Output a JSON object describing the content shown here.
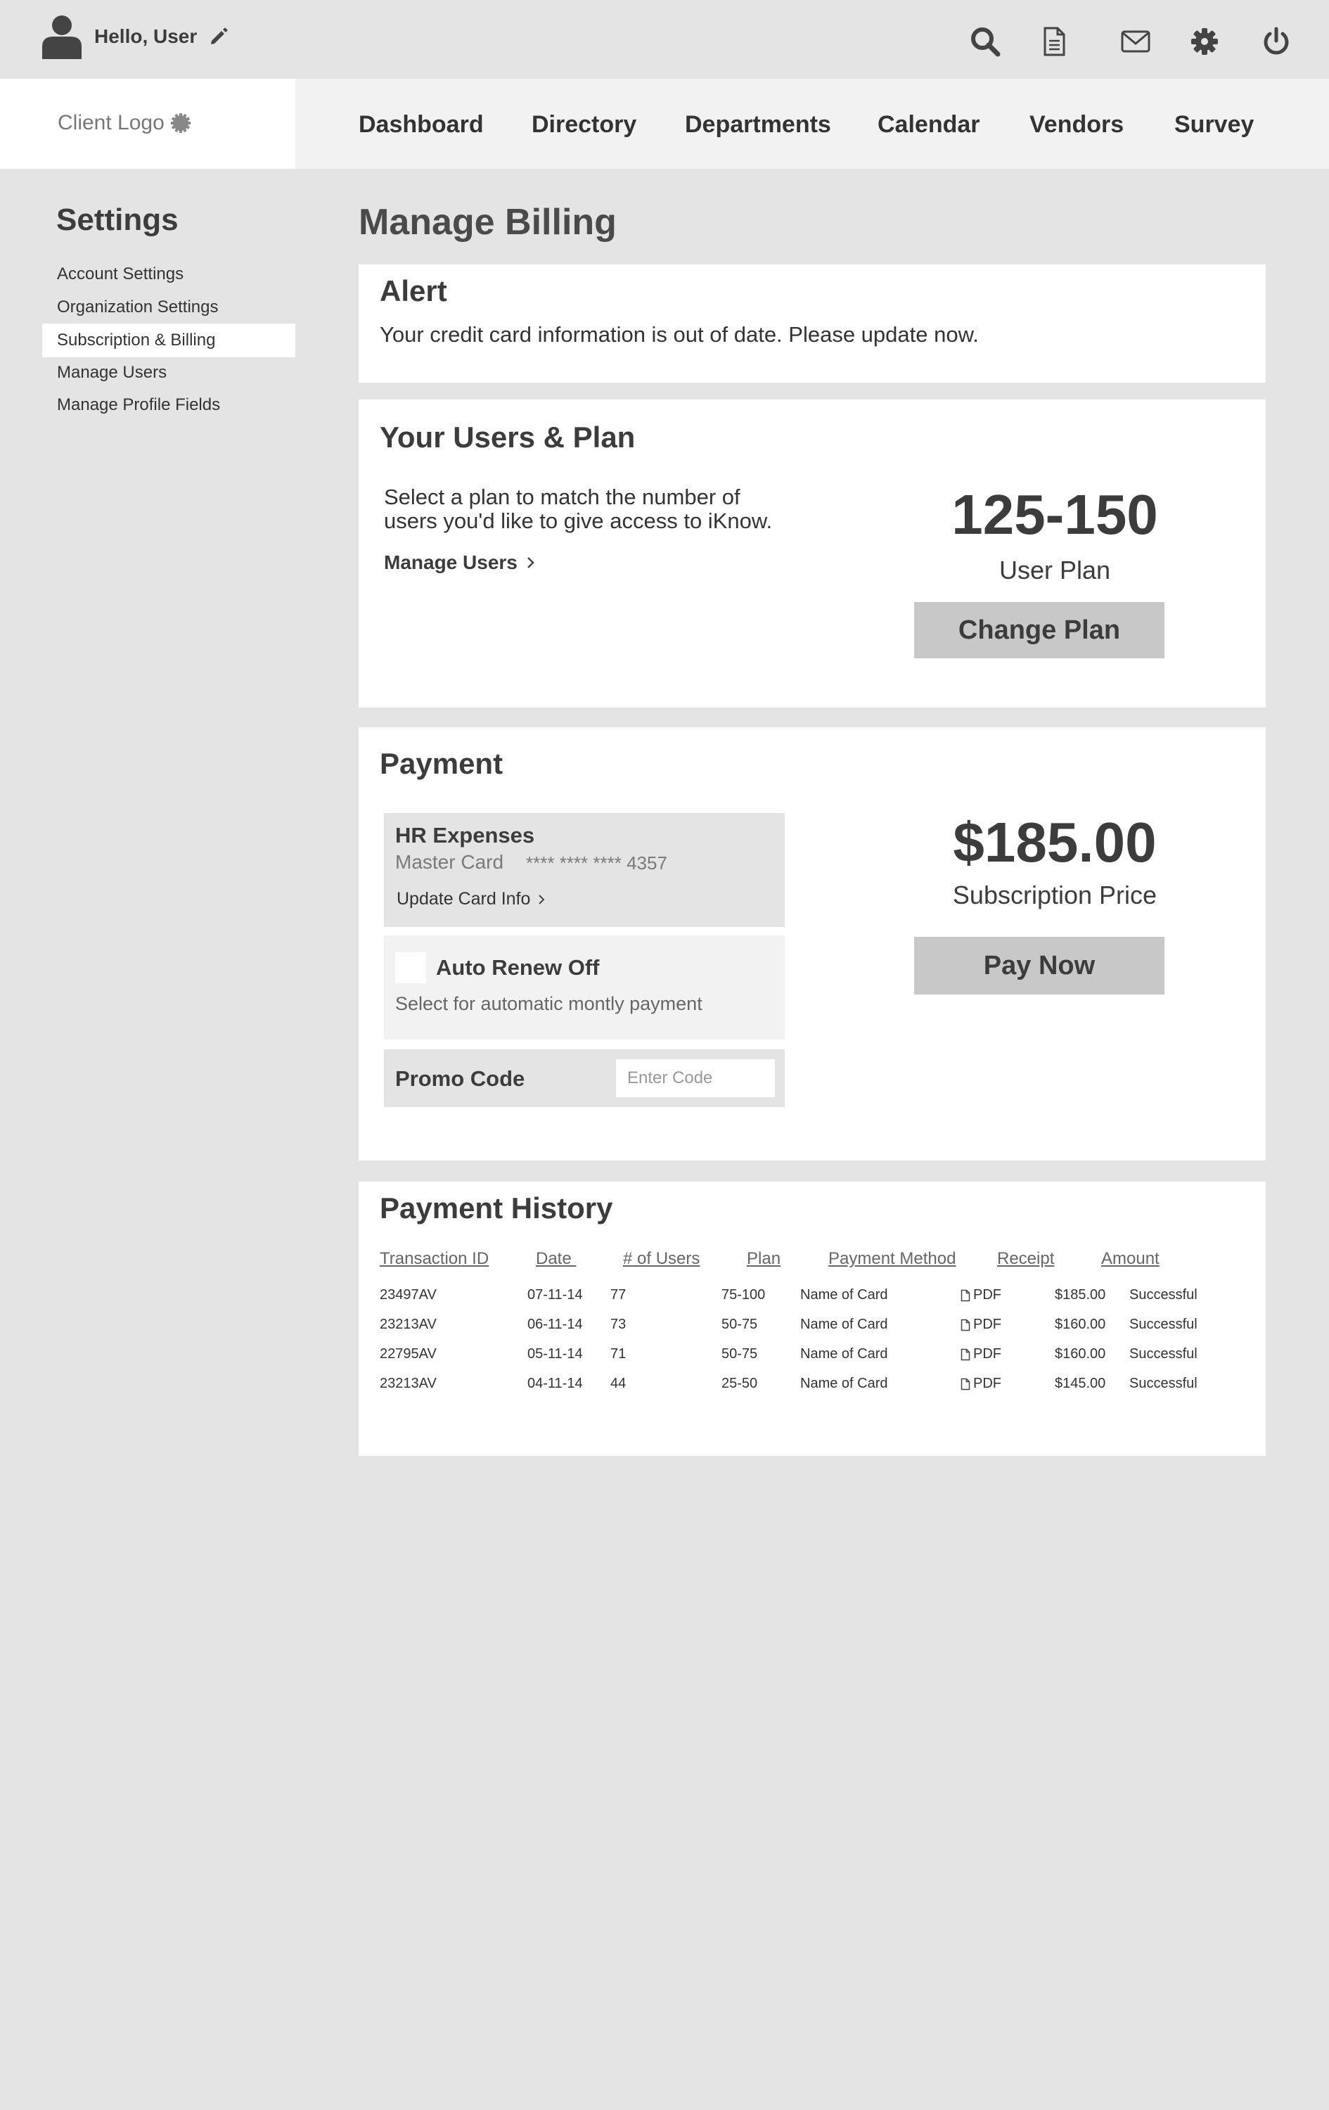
{
  "header": {
    "greeting": "Hello, User",
    "icons": [
      "search-icon",
      "document-icon",
      "mail-icon",
      "gear-icon",
      "power-icon"
    ]
  },
  "nav": {
    "logo": "Client Logo",
    "items": [
      "Dashboard",
      "Directory",
      "Departments",
      "Calendar",
      "Vendors",
      "Survey"
    ]
  },
  "sidebar": {
    "title": "Settings",
    "items": [
      {
        "label": "Account Settings",
        "active": false
      },
      {
        "label": "Organization Settings",
        "active": false
      },
      {
        "label": "Subscription & Billing",
        "active": true
      },
      {
        "label": "Manage Users",
        "active": false
      },
      {
        "label": "Manage Profile Fields",
        "active": false
      }
    ]
  },
  "main": {
    "title": "Manage Billing",
    "alert": {
      "title": "Alert",
      "text": "Your credit card information is out of date. Please update now."
    },
    "plan": {
      "title": "Your Users & Plan",
      "description": "Select a plan to match the number of users you'd like to give access to iKnow.",
      "manage_link": "Manage Users",
      "range": "125-150",
      "range_label": "User Plan",
      "button": "Change Plan"
    },
    "payment": {
      "title": "Payment",
      "card_name": "HR Expenses",
      "card_type": "Master Card",
      "card_number": "**** **** **** 4357",
      "update_link": "Update Card Info",
      "renew_title": "Auto Renew Off",
      "renew_desc": "Select for automatic montly payment",
      "promo_label": "Promo Code",
      "promo_placeholder": "Enter Code",
      "price": "$185.00",
      "price_label": "Subscription Price",
      "button": "Pay Now"
    },
    "history": {
      "title": "Payment History",
      "columns": [
        "Transaction ID",
        "Date ",
        "# of Users",
        "Plan",
        "Payment Method",
        "Receipt",
        "Amount"
      ],
      "rows": [
        {
          "id": "23497AV",
          "date": "07-11-14",
          "users": "77",
          "plan": "75-100",
          "method": "Name of Card",
          "receipt": "PDF",
          "amount": "$185.00",
          "status": "Successful"
        },
        {
          "id": "23213AV",
          "date": "06-11-14",
          "users": "73",
          "plan": "50-75",
          "method": "Name of Card",
          "receipt": "PDF",
          "amount": "$160.00",
          "status": "Successful"
        },
        {
          "id": "22795AV",
          "date": "05-11-14",
          "users": "71",
          "plan": "50-75",
          "method": "Name of Card",
          "receipt": "PDF",
          "amount": "$160.00",
          "status": "Successful"
        },
        {
          "id": "23213AV",
          "date": "04-11-14",
          "users": "44",
          "plan": "25-50",
          "method": "Name of Card",
          "receipt": "PDF",
          "amount": "$145.00",
          "status": "Successful"
        }
      ]
    }
  }
}
